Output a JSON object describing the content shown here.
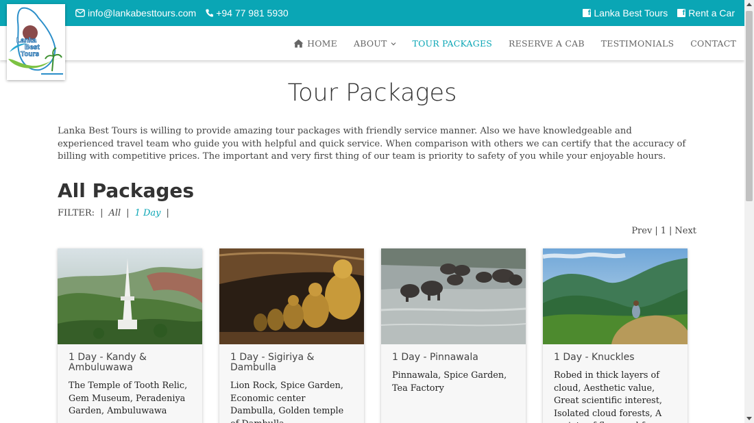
{
  "topbar": {
    "email": "info@lankabesttours.com",
    "phone": "+94 77 981 5930",
    "social": [
      {
        "label": "Lanka Best Tours",
        "icon": "facebook-icon"
      },
      {
        "label": "Rent a Car",
        "icon": "facebook-icon"
      }
    ],
    "bg_color": "#0aa6b5"
  },
  "logo": {
    "text_line1": "Lanka",
    "text_line2": "Best",
    "text_line3": "Tours"
  },
  "nav": {
    "items": [
      {
        "label": "HOME",
        "icon": "home-icon",
        "active": false
      },
      {
        "label": "ABOUT",
        "dropdown": true,
        "active": false
      },
      {
        "label": "TOUR PACKAGES",
        "active": true
      },
      {
        "label": "RESERVE A CAB",
        "active": false
      },
      {
        "label": "TESTIMONIALS",
        "active": false
      },
      {
        "label": "CONTACT",
        "active": false
      }
    ],
    "accent": "#0aa6b5"
  },
  "page": {
    "title": "Tour Packages",
    "intro": "Lanka Best Tours is willing to provide amazing tour packages with friendly service manner. Also we have knowledgeable and experienced travel team who guide you with helpful and quick service. When comparison with others we can certify that the accuracy of billing with competitive prices. The important and very first thing of our team is priority to safety of you while your enjoyable hours.",
    "section_title": "All Packages"
  },
  "filter": {
    "label": "FILTER:",
    "separator": "|",
    "options": [
      {
        "label": "All",
        "active": false
      },
      {
        "label": "1 Day",
        "active": true
      }
    ]
  },
  "pager": {
    "prev": "Prev",
    "sep": "|",
    "page": "1",
    "next": "Next"
  },
  "packages": [
    {
      "title": "1 Day - Kandy & Ambuluwawa",
      "desc": "The Temple of Tooth Relic, Gem Museum, Peradeniya Garden, Ambuluwawa",
      "image": "ambuluwawa-tower-photo"
    },
    {
      "title": "1 Day - Sigiriya & Dambulla",
      "desc": "Lion Rock, Spice Garden, Economic center Dambulla, Golden temple of Dambulla",
      "image": "dambulla-buddha-statues-photo"
    },
    {
      "title": "1 Day - Pinnawala",
      "desc": "Pinnawala, Spice Garden, Tea Factory",
      "image": "pinnawala-elephants-photo"
    },
    {
      "title": "1 Day - Knuckles",
      "desc": "Robed in thick layers of cloud, Aesthetic value, Great scientific interest, Isolated cloud forests, A variety of flora and fauna",
      "image": "knuckles-mountain-photo"
    }
  ]
}
